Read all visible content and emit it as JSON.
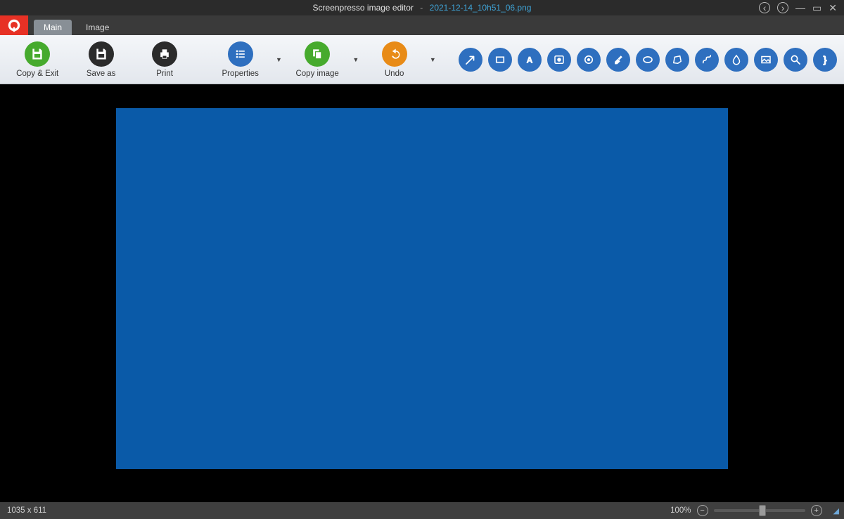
{
  "title": {
    "app": "Screenpresso image editor",
    "separator": "-",
    "file": "2021-12-14_10h51_06.png"
  },
  "tabs": [
    {
      "label": "Main",
      "active": true
    },
    {
      "label": "Image",
      "active": false
    }
  ],
  "ribbon": {
    "big_tools": [
      {
        "id": "copy-exit",
        "label": "Copy & Exit",
        "color": "big-green",
        "has_dropdown": false
      },
      {
        "id": "save-as",
        "label": "Save as",
        "color": "big-dark",
        "has_dropdown": false
      },
      {
        "id": "print",
        "label": "Print",
        "color": "big-dark",
        "has_dropdown": false
      },
      {
        "id": "properties",
        "label": "Properties",
        "color": "big-blue",
        "has_dropdown": true
      },
      {
        "id": "copy-image",
        "label": "Copy image",
        "color": "big-green",
        "has_dropdown": true
      },
      {
        "id": "undo",
        "label": "Undo",
        "color": "big-orange",
        "has_dropdown": true
      }
    ],
    "small_tools": [
      "arrow",
      "rectangle",
      "text",
      "number-stamp",
      "circle-dot",
      "highlight",
      "ellipse",
      "polygon",
      "curve",
      "blur",
      "image",
      "magnify",
      "brace"
    ]
  },
  "canvas": {
    "image_color": "#0a5aa8"
  },
  "status": {
    "dimensions": "1035 x 611",
    "zoom_label": "100%"
  }
}
